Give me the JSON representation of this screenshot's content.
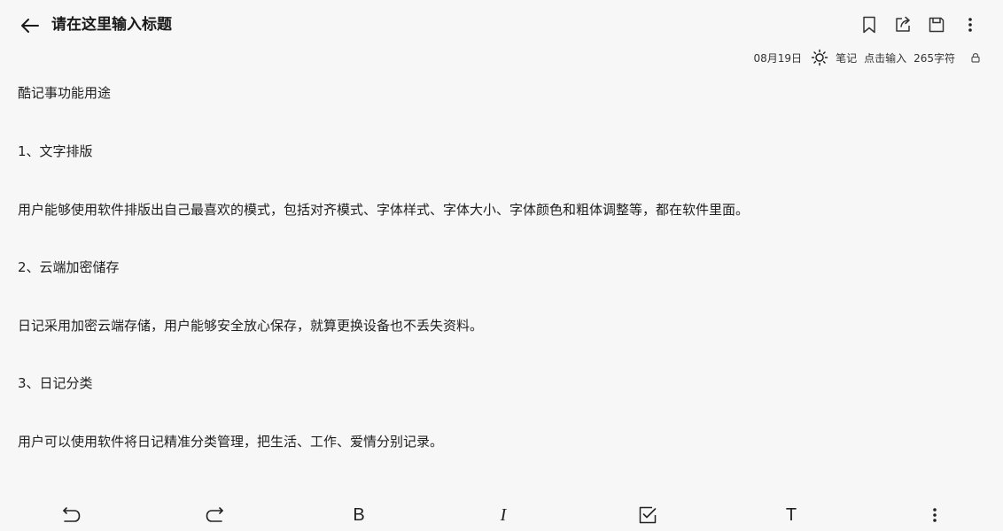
{
  "header": {
    "title": "请在这里输入标题",
    "icons": [
      "back-arrow-icon",
      "bookmark-icon",
      "share-icon",
      "save-icon",
      "more-vertical-icon"
    ]
  },
  "meta": {
    "date": "08月19日",
    "category": "笔记",
    "hint": "点击输入",
    "char_count": "265字符",
    "icons": [
      "sun-icon",
      "lock-icon"
    ]
  },
  "content": {
    "paragraphs": [
      "酷记事功能用途",
      "1、文字排版",
      "用户能够使用软件排版出自己最喜欢的模式，包括对齐模式、字体样式、字体大小、字体颜色和粗体调整等，都在软件里面。",
      "2、云端加密储存",
      "日记采用加密云端存储，用户能够安全放心保存，就算更换设备也不丢失资料。",
      "3、日记分类",
      "用户可以使用软件将日记精准分类管理，把生活、工作、爱情分别记录。"
    ]
  },
  "toolbar": {
    "bold_label": "B",
    "italic_label": "I",
    "text_label": "T",
    "icons": [
      "undo-icon",
      "redo-icon",
      "bold-icon",
      "italic-icon",
      "checkbox-icon",
      "text-style-icon",
      "more-vertical-icon"
    ]
  }
}
